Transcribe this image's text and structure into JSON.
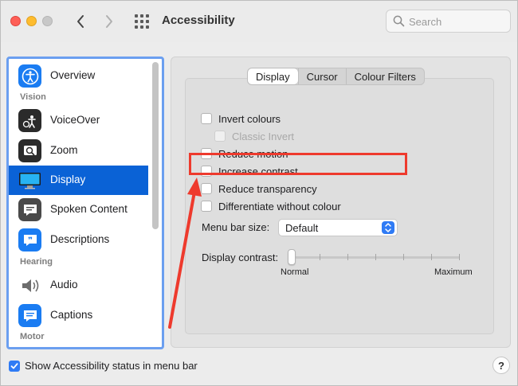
{
  "window": {
    "title": "Accessibility",
    "search_placeholder": "Search"
  },
  "sidebar": {
    "sections": [
      {
        "label": "Vision"
      },
      {
        "label": "Hearing"
      },
      {
        "label": "Motor"
      }
    ],
    "items": [
      {
        "label": "Overview",
        "icon": "accessibility-person-icon"
      },
      {
        "label": "VoiceOver",
        "icon": "voiceover-icon"
      },
      {
        "label": "Zoom",
        "icon": "zoom-icon"
      },
      {
        "label": "Display",
        "icon": "display-monitor-icon",
        "selected": true
      },
      {
        "label": "Spoken Content",
        "icon": "speech-bubble-icon"
      },
      {
        "label": "Descriptions",
        "icon": "quote-bubble-icon"
      },
      {
        "label": "Audio",
        "icon": "speaker-icon"
      },
      {
        "label": "Captions",
        "icon": "captions-icon"
      }
    ]
  },
  "tabs": [
    {
      "label": "Display",
      "active": true
    },
    {
      "label": "Cursor",
      "active": false
    },
    {
      "label": "Colour Filters",
      "active": false
    }
  ],
  "options": [
    {
      "label": "Invert colours",
      "checked": false,
      "disabled": false
    },
    {
      "label": "Classic Invert",
      "checked": false,
      "disabled": true
    },
    {
      "label": "Reduce motion",
      "checked": false,
      "disabled": false
    },
    {
      "label": "Increase contrast",
      "checked": false,
      "disabled": false
    },
    {
      "label": "Reduce transparency",
      "checked": false,
      "disabled": false
    },
    {
      "label": "Differentiate without colour",
      "checked": false,
      "disabled": false
    }
  ],
  "menu_bar_size": {
    "label": "Menu bar size:",
    "value": "Default"
  },
  "display_contrast": {
    "label": "Display contrast:",
    "min_label": "Normal",
    "max_label": "Maximum",
    "value_fraction": 0
  },
  "footer": {
    "status_label": "Show Accessibility status in menu bar",
    "status_checked": true,
    "help_label": "?"
  },
  "colors": {
    "accent": "#0a62d6",
    "annotation": "#ee3a2d"
  }
}
